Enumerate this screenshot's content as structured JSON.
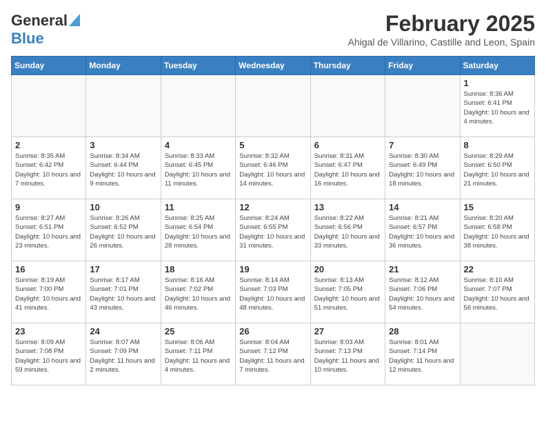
{
  "header": {
    "logo_general": "General",
    "logo_blue": "Blue",
    "month_year": "February 2025",
    "location": "Ahigal de Villarino, Castille and Leon, Spain"
  },
  "weekdays": [
    "Sunday",
    "Monday",
    "Tuesday",
    "Wednesday",
    "Thursday",
    "Friday",
    "Saturday"
  ],
  "weeks": [
    [
      {
        "day": "",
        "info": ""
      },
      {
        "day": "",
        "info": ""
      },
      {
        "day": "",
        "info": ""
      },
      {
        "day": "",
        "info": ""
      },
      {
        "day": "",
        "info": ""
      },
      {
        "day": "",
        "info": ""
      },
      {
        "day": "1",
        "info": "Sunrise: 8:36 AM\nSunset: 6:41 PM\nDaylight: 10 hours and 4 minutes."
      }
    ],
    [
      {
        "day": "2",
        "info": "Sunrise: 8:35 AM\nSunset: 6:42 PM\nDaylight: 10 hours and 7 minutes."
      },
      {
        "day": "3",
        "info": "Sunrise: 8:34 AM\nSunset: 6:44 PM\nDaylight: 10 hours and 9 minutes."
      },
      {
        "day": "4",
        "info": "Sunrise: 8:33 AM\nSunset: 6:45 PM\nDaylight: 10 hours and 11 minutes."
      },
      {
        "day": "5",
        "info": "Sunrise: 8:32 AM\nSunset: 6:46 PM\nDaylight: 10 hours and 14 minutes."
      },
      {
        "day": "6",
        "info": "Sunrise: 8:31 AM\nSunset: 6:47 PM\nDaylight: 10 hours and 16 minutes."
      },
      {
        "day": "7",
        "info": "Sunrise: 8:30 AM\nSunset: 6:49 PM\nDaylight: 10 hours and 18 minutes."
      },
      {
        "day": "8",
        "info": "Sunrise: 8:29 AM\nSunset: 6:50 PM\nDaylight: 10 hours and 21 minutes."
      }
    ],
    [
      {
        "day": "9",
        "info": "Sunrise: 8:27 AM\nSunset: 6:51 PM\nDaylight: 10 hours and 23 minutes."
      },
      {
        "day": "10",
        "info": "Sunrise: 8:26 AM\nSunset: 6:52 PM\nDaylight: 10 hours and 26 minutes."
      },
      {
        "day": "11",
        "info": "Sunrise: 8:25 AM\nSunset: 6:54 PM\nDaylight: 10 hours and 28 minutes."
      },
      {
        "day": "12",
        "info": "Sunrise: 8:24 AM\nSunset: 6:55 PM\nDaylight: 10 hours and 31 minutes."
      },
      {
        "day": "13",
        "info": "Sunrise: 8:22 AM\nSunset: 6:56 PM\nDaylight: 10 hours and 33 minutes."
      },
      {
        "day": "14",
        "info": "Sunrise: 8:21 AM\nSunset: 6:57 PM\nDaylight: 10 hours and 36 minutes."
      },
      {
        "day": "15",
        "info": "Sunrise: 8:20 AM\nSunset: 6:58 PM\nDaylight: 10 hours and 38 minutes."
      }
    ],
    [
      {
        "day": "16",
        "info": "Sunrise: 8:19 AM\nSunset: 7:00 PM\nDaylight: 10 hours and 41 minutes."
      },
      {
        "day": "17",
        "info": "Sunrise: 8:17 AM\nSunset: 7:01 PM\nDaylight: 10 hours and 43 minutes."
      },
      {
        "day": "18",
        "info": "Sunrise: 8:16 AM\nSunset: 7:02 PM\nDaylight: 10 hours and 46 minutes."
      },
      {
        "day": "19",
        "info": "Sunrise: 8:14 AM\nSunset: 7:03 PM\nDaylight: 10 hours and 48 minutes."
      },
      {
        "day": "20",
        "info": "Sunrise: 8:13 AM\nSunset: 7:05 PM\nDaylight: 10 hours and 51 minutes."
      },
      {
        "day": "21",
        "info": "Sunrise: 8:12 AM\nSunset: 7:06 PM\nDaylight: 10 hours and 54 minutes."
      },
      {
        "day": "22",
        "info": "Sunrise: 8:10 AM\nSunset: 7:07 PM\nDaylight: 10 hours and 56 minutes."
      }
    ],
    [
      {
        "day": "23",
        "info": "Sunrise: 8:09 AM\nSunset: 7:08 PM\nDaylight: 10 hours and 59 minutes."
      },
      {
        "day": "24",
        "info": "Sunrise: 8:07 AM\nSunset: 7:09 PM\nDaylight: 11 hours and 2 minutes."
      },
      {
        "day": "25",
        "info": "Sunrise: 8:06 AM\nSunset: 7:11 PM\nDaylight: 11 hours and 4 minutes."
      },
      {
        "day": "26",
        "info": "Sunrise: 8:04 AM\nSunset: 7:12 PM\nDaylight: 11 hours and 7 minutes."
      },
      {
        "day": "27",
        "info": "Sunrise: 8:03 AM\nSunset: 7:13 PM\nDaylight: 11 hours and 10 minutes."
      },
      {
        "day": "28",
        "info": "Sunrise: 8:01 AM\nSunset: 7:14 PM\nDaylight: 11 hours and 12 minutes."
      },
      {
        "day": "",
        "info": ""
      }
    ]
  ]
}
